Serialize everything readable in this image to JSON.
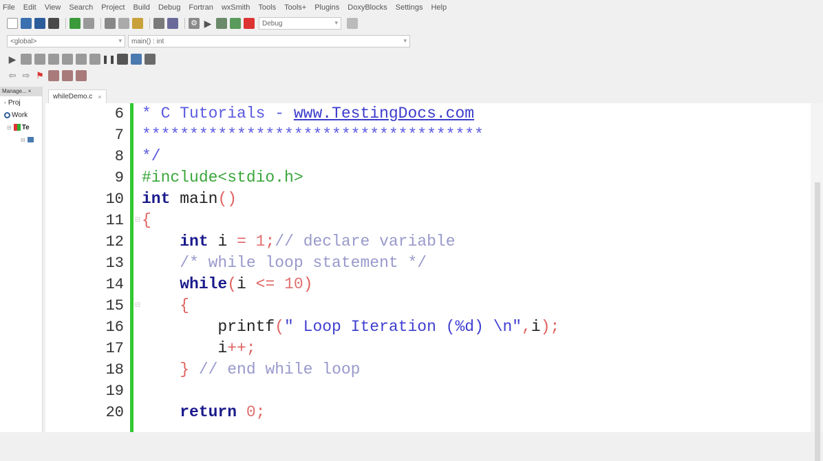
{
  "menu": [
    "File",
    "Edit",
    "View",
    "Search",
    "Project",
    "Build",
    "Debug",
    "Fortran",
    "wxSmith",
    "Tools",
    "Tools+",
    "Plugins",
    "DoxyBlocks",
    "Settings",
    "Help"
  ],
  "toolbar": {
    "build_target": "Debug",
    "scope_value": "<global>",
    "function_value": "main() : int"
  },
  "management": {
    "tab_label": "Manage... ×",
    "projects_tab": "Proj",
    "workspace": "Work",
    "project_item": "Te"
  },
  "editor": {
    "tab_label": "whileDemo.c",
    "tab_close": "×",
    "lines": [
      {
        "n": "6",
        "fold": "",
        "segments": [
          {
            "t": "* C Tutorials - ",
            "k": "doc"
          },
          {
            "t": "www.TestingDocs.com",
            "k": "url"
          }
        ]
      },
      {
        "n": "7",
        "fold": "",
        "segments": [
          {
            "t": "************************************",
            "k": "doc"
          }
        ]
      },
      {
        "n": "8",
        "fold": "",
        "segments": [
          {
            "t": "*/",
            "k": "doc"
          }
        ]
      },
      {
        "n": "9",
        "fold": "",
        "segments": [
          {
            "t": "#include<stdio.h>",
            "k": "pre"
          }
        ]
      },
      {
        "n": "10",
        "fold": "",
        "segments": [
          {
            "t": "int",
            "k": "kw"
          },
          {
            "t": " main",
            "k": "plain"
          },
          {
            "t": "()",
            "k": "op"
          }
        ]
      },
      {
        "n": "11",
        "fold": "⊟",
        "segments": [
          {
            "t": "{",
            "k": "op"
          }
        ]
      },
      {
        "n": "12",
        "fold": "",
        "segments": [
          {
            "t": "    ",
            "k": "plain"
          },
          {
            "t": "int",
            "k": "kw"
          },
          {
            "t": " i ",
            "k": "plain"
          },
          {
            "t": "=",
            "k": "op"
          },
          {
            "t": " 1",
            "k": "num"
          },
          {
            "t": ";",
            "k": "op"
          },
          {
            "t": "// declare variable",
            "k": "comment"
          }
        ]
      },
      {
        "n": "13",
        "fold": "",
        "segments": [
          {
            "t": "    ",
            "k": "plain"
          },
          {
            "t": "/* while loop statement */",
            "k": "comment"
          }
        ]
      },
      {
        "n": "14",
        "fold": "",
        "segments": [
          {
            "t": "    ",
            "k": "plain"
          },
          {
            "t": "while",
            "k": "kw"
          },
          {
            "t": "(",
            "k": "op"
          },
          {
            "t": "i ",
            "k": "plain"
          },
          {
            "t": "<=",
            "k": "op"
          },
          {
            "t": " 10",
            "k": "num"
          },
          {
            "t": ")",
            "k": "op"
          }
        ]
      },
      {
        "n": "15",
        "fold": "⊟",
        "segments": [
          {
            "t": "    ",
            "k": "plain"
          },
          {
            "t": "{",
            "k": "op"
          }
        ]
      },
      {
        "n": "16",
        "fold": "",
        "segments": [
          {
            "t": "        printf",
            "k": "plain"
          },
          {
            "t": "(",
            "k": "op"
          },
          {
            "t": "\" Loop Iteration (%d) \\n\"",
            "k": "str"
          },
          {
            "t": ",",
            "k": "op"
          },
          {
            "t": "i",
            "k": "plain"
          },
          {
            "t": ");",
            "k": "op"
          }
        ]
      },
      {
        "n": "17",
        "fold": "",
        "segments": [
          {
            "t": "        i",
            "k": "plain"
          },
          {
            "t": "++;",
            "k": "op"
          }
        ]
      },
      {
        "n": "18",
        "fold": "",
        "segments": [
          {
            "t": "    ",
            "k": "plain"
          },
          {
            "t": "}",
            "k": "op"
          },
          {
            "t": " // end while loop",
            "k": "comment"
          }
        ]
      },
      {
        "n": "19",
        "fold": "",
        "segments": []
      },
      {
        "n": "20",
        "fold": "",
        "segments": [
          {
            "t": "    ",
            "k": "plain"
          },
          {
            "t": "return",
            "k": "kw"
          },
          {
            "t": " 0",
            "k": "num"
          },
          {
            "t": ";",
            "k": "op"
          }
        ]
      }
    ]
  },
  "colors": {
    "change_bar": "#32c832",
    "keyword": "#1a1a8c",
    "preprocessor": "#3aa63a",
    "comment": "#9999cc",
    "operator": "#e06060"
  }
}
